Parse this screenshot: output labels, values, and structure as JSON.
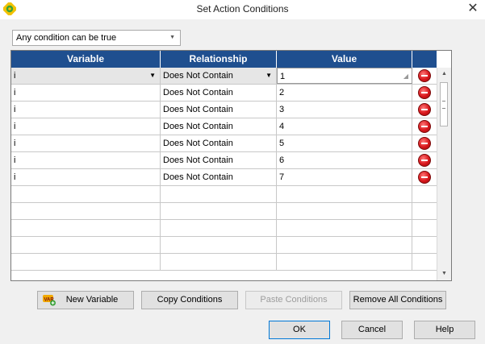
{
  "window": {
    "title": "Set Action Conditions",
    "close_glyph": "✕"
  },
  "condition_mode": {
    "selected": "Any condition can be true"
  },
  "grid": {
    "columns": [
      "Variable",
      "Relationship",
      "Value"
    ],
    "rows": [
      {
        "variable": "i",
        "relationship": "Does Not Contain",
        "value": "1"
      },
      {
        "variable": "i",
        "relationship": "Does Not Contain",
        "value": "2"
      },
      {
        "variable": "i",
        "relationship": "Does Not Contain",
        "value": "3"
      },
      {
        "variable": "i",
        "relationship": "Does Not Contain",
        "value": "4"
      },
      {
        "variable": "i",
        "relationship": "Does Not Contain",
        "value": "5"
      },
      {
        "variable": "i",
        "relationship": "Does Not Contain",
        "value": "6"
      },
      {
        "variable": "i",
        "relationship": "Does Not Contain",
        "value": "7"
      }
    ],
    "empty_row_count": 5
  },
  "toolbar": {
    "new_variable": "New Variable",
    "copy_conditions": "Copy Conditions",
    "paste_conditions": "Paste Conditions",
    "remove_all_conditions": "Remove All Conditions"
  },
  "footer": {
    "ok": "OK",
    "cancel": "Cancel",
    "help": "Help"
  },
  "icons": {
    "app": "app-gear-icon",
    "delete": "remove-circle-icon",
    "new_variable": "var-icon"
  },
  "colors": {
    "header_bg": "#1f4f8f",
    "delete_red": "#d8161b"
  }
}
